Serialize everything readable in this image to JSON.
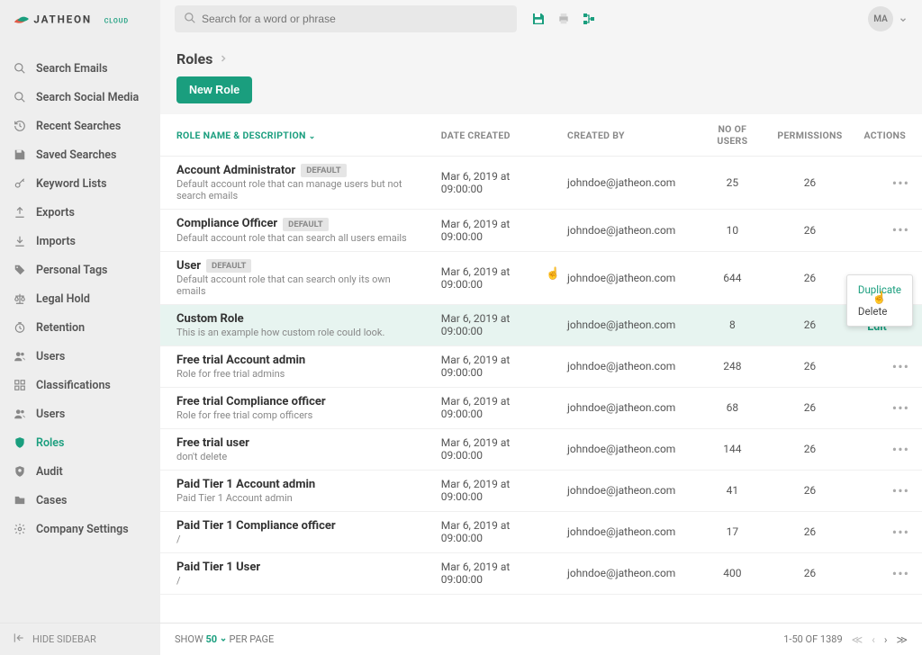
{
  "brand": {
    "name_main": "JATHEON",
    "name_sub": "CLOUD"
  },
  "search": {
    "placeholder": "Search for a word or phrase"
  },
  "avatar": {
    "initials": "MA"
  },
  "sidebar": {
    "items": [
      {
        "label": "Search Emails",
        "icon": "search-icon"
      },
      {
        "label": "Search Social Media",
        "icon": "search-icon"
      },
      {
        "label": "Recent Searches",
        "icon": "history-icon"
      },
      {
        "label": "Saved Searches",
        "icon": "save-icon"
      },
      {
        "label": "Keyword Lists",
        "icon": "key-icon"
      },
      {
        "label": "Exports",
        "icon": "upload-icon"
      },
      {
        "label": "Imports",
        "icon": "download-icon"
      },
      {
        "label": "Personal Tags",
        "icon": "tag-icon"
      },
      {
        "label": "Legal Hold",
        "icon": "scale-icon"
      },
      {
        "label": "Retention",
        "icon": "clock-icon"
      },
      {
        "label": "Users",
        "icon": "users-icon"
      },
      {
        "label": "Classifications",
        "icon": "grid-icon"
      },
      {
        "label": "Users",
        "icon": "users-icon"
      },
      {
        "label": "Roles",
        "icon": "shield-icon"
      },
      {
        "label": "Audit",
        "icon": "audit-icon"
      },
      {
        "label": "Cases",
        "icon": "folder-icon"
      },
      {
        "label": "Company Settings",
        "icon": "gear-icon"
      }
    ],
    "hide_label": "HIDE SIDEBAR"
  },
  "page": {
    "title": "Roles",
    "new_button": "New Role"
  },
  "table": {
    "headers": {
      "name": "ROLE NAME & DESCRIPTION",
      "date": "DATE CREATED",
      "creator": "CREATED BY",
      "users": "NO OF USERS",
      "perms": "PERMISSIONS",
      "actions": "ACTIONS"
    },
    "rows": [
      {
        "name": "Account Administrator",
        "badge": "DEFAULT",
        "desc": "Default account role that can manage users but not search emails",
        "date": "Mar 6, 2019 at 09:00:00",
        "creator": "johndoe@jatheon.com",
        "users": "25",
        "perms": "26"
      },
      {
        "name": "Compliance Officer",
        "badge": "DEFAULT",
        "desc": "Default account role that can search all users emails",
        "date": "Mar 6, 2019 at 09:00:00",
        "creator": "johndoe@jatheon.com",
        "users": "10",
        "perms": "26"
      },
      {
        "name": "User",
        "badge": "DEFAULT",
        "desc": "Default account role that can search only its own emails",
        "date": "Mar 6, 2019 at 09:00:00",
        "creator": "johndoe@jatheon.com",
        "users": "644",
        "perms": "26"
      },
      {
        "name": "Custom Role",
        "badge": "",
        "desc": "This is an example how custom role could look.",
        "date": "Mar 6, 2019 at 09:00:00",
        "creator": "johndoe@jatheon.com",
        "users": "8",
        "perms": "26",
        "highlight": true,
        "edit": "Edit"
      },
      {
        "name": "Free trial Account admin",
        "badge": "",
        "desc": "Role for free trial admins",
        "date": "Mar 6, 2019 at 09:00:00",
        "creator": "johndoe@jatheon.com",
        "users": "248",
        "perms": "26"
      },
      {
        "name": "Free trial Compliance officer",
        "badge": "",
        "desc": "Role for free trial comp officers",
        "date": "Mar 6, 2019 at 09:00:00",
        "creator": "johndoe@jatheon.com",
        "users": "68",
        "perms": "26"
      },
      {
        "name": "Free trial user",
        "badge": "",
        "desc": "don't delete",
        "date": "Mar 6, 2019 at 09:00:00",
        "creator": "johndoe@jatheon.com",
        "users": "144",
        "perms": "26"
      },
      {
        "name": "Paid Tier 1 Account admin",
        "badge": "",
        "desc": "Paid Tier 1 Account admin",
        "date": "Mar 6, 2019 at 09:00:00",
        "creator": "johndoe@jatheon.com",
        "users": "41",
        "perms": "26"
      },
      {
        "name": "Paid Tier 1 Compliance officer",
        "badge": "",
        "desc": "/",
        "date": "Mar 6, 2019 at 09:00:00",
        "creator": "johndoe@jatheon.com",
        "users": "17",
        "perms": "26"
      },
      {
        "name": "Paid Tier 1 User",
        "badge": "",
        "desc": "/",
        "date": "Mar 6, 2019 at 09:00:00",
        "creator": "johndoe@jatheon.com",
        "users": "400",
        "perms": "26"
      }
    ]
  },
  "context_menu": {
    "duplicate": "Duplicate",
    "delete": "Delete"
  },
  "footer": {
    "show_label": "SHOW",
    "show_value": "50",
    "per_page": "PER PAGE",
    "range": "1-50 OF 1389"
  }
}
